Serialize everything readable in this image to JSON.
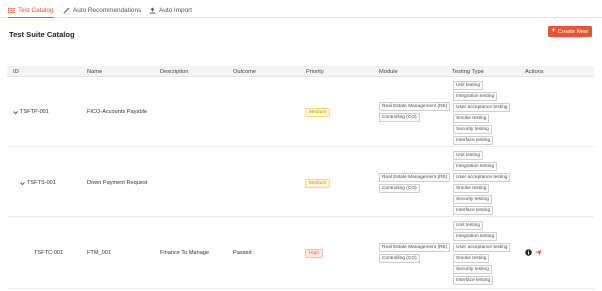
{
  "tabs": [
    {
      "label": "Test Catalog",
      "icon": "list-icon"
    },
    {
      "label": "Auto Recommendations",
      "icon": "magic-wand-icon"
    },
    {
      "label": "Auto Import",
      "icon": "upload-icon"
    }
  ],
  "page": {
    "title": "Test Suite Catalog",
    "create_label": "Create New"
  },
  "columns": [
    "ID",
    "Name",
    "Description",
    "Outcome",
    "Priority",
    "Module",
    "Testing Type",
    "Actions"
  ],
  "rows": [
    {
      "id": "TSFTP-001",
      "name": "FICO-Accounts Payable",
      "description": "",
      "outcome": "",
      "priority": "Medium",
      "modules": [
        "Real Estate Management (RE)",
        "Controlling (CO)"
      ],
      "testing_types": [
        "Unit testing",
        "Integration testing",
        "User acceptance testing",
        "Smoke testing",
        "Security testing",
        "Interface testing"
      ]
    },
    {
      "id": "TSFTS-001",
      "name": "Down Payment Request",
      "description": "",
      "outcome": "",
      "priority": "Medium",
      "modules": [
        "Real Estate Management (RE)",
        "Controlling (CO)"
      ],
      "testing_types": [
        "Unit testing",
        "Integration testing",
        "User acceptance testing",
        "Smoke testing",
        "Security testing",
        "Interface testing"
      ]
    },
    {
      "id": "TSFTC-001",
      "name": "FTM_001",
      "description": "Finance To Manage",
      "outcome": "Passed",
      "priority": "High",
      "modules": [
        "Real Estate Management (RE)",
        "Controlling (CO)"
      ],
      "testing_types": [
        "Unit testing",
        "Integration testing",
        "User acceptance testing",
        "Smoke testing",
        "Security testing",
        "Interface testing"
      ]
    }
  ],
  "colors": {
    "accent": "#e8552f",
    "priority_medium": "#c9961a",
    "priority_high": "#e56a4b"
  }
}
